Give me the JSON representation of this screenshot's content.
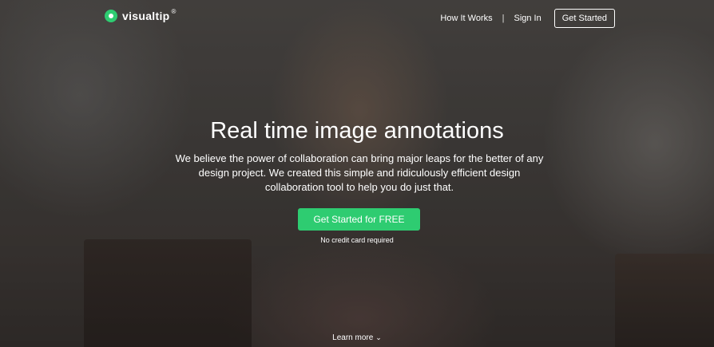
{
  "header": {
    "logo_text": "visualtip",
    "logo_mark": "®",
    "nav": {
      "how_it_works": "How It Works",
      "separator": "|",
      "sign_in": "Sign In",
      "get_started": "Get Started"
    }
  },
  "hero": {
    "title": "Real time image annotations",
    "subtitle": "We believe the power of collaboration can bring major leaps for the better of any design project. We created this simple and ridiculously efficient design collaboration tool to help you do just that.",
    "cta_label": "Get Started for FREE",
    "cta_note": "No credit card required",
    "learn_more": "Learn more"
  },
  "icons": {
    "logo": "chat-bubble-logo-icon",
    "learn_more": "chevron-down-icon"
  },
  "colors": {
    "accent": "#2ecc71",
    "text": "#ffffff"
  }
}
